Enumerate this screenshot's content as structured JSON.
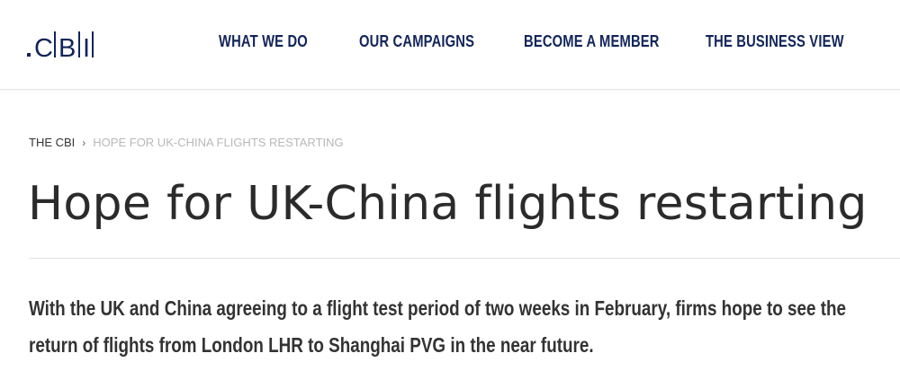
{
  "header": {
    "logo": {
      "letters": [
        "C",
        "B",
        "I"
      ]
    },
    "nav": [
      {
        "label": "WHAT WE DO"
      },
      {
        "label": "OUR CAMPAIGNS"
      },
      {
        "label": "BECOME A MEMBER"
      },
      {
        "label": "THE BUSINESS VIEW"
      }
    ]
  },
  "breadcrumb": {
    "home": "THE CBI",
    "separator": "›",
    "current": "HOPE FOR UK-CHINA FLIGHTS RESTARTING"
  },
  "article": {
    "title": "Hope for UK-China flights restarting",
    "summary": "With the UK and China agreeing to a flight test period of two weeks in February, firms hope to see the return of flights from London LHR to Shanghai PVG in the near future."
  },
  "colors": {
    "brand_navy": "#12245a",
    "text_dark": "#2b2b2b",
    "breadcrumb_muted": "#b8b8b8"
  }
}
